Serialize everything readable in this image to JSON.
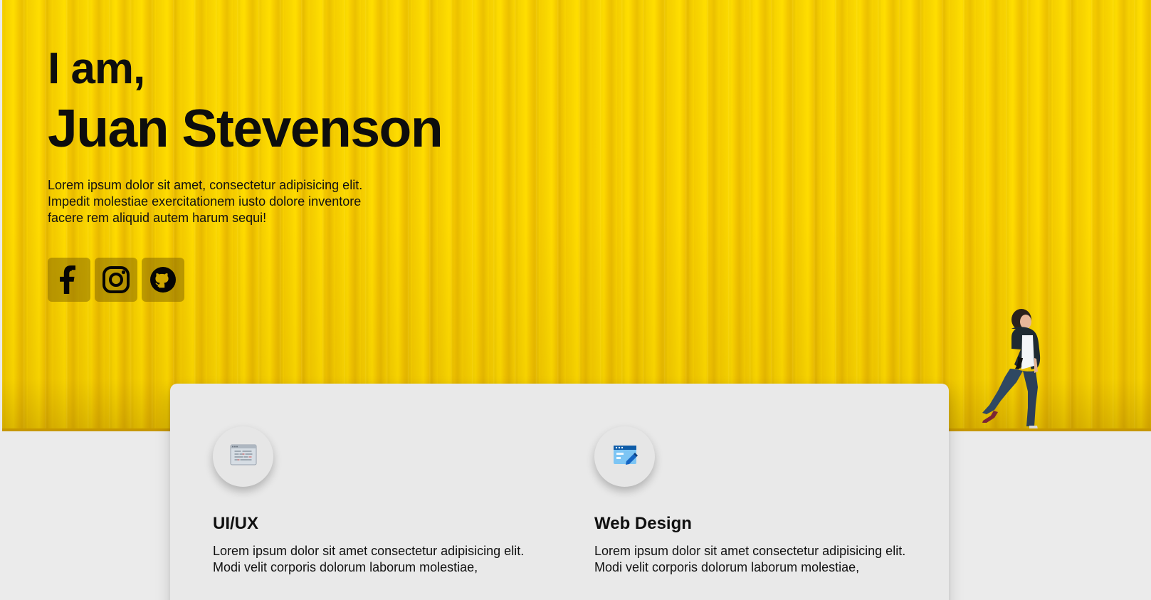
{
  "hero": {
    "intro_small": "I am,",
    "name": "Juan Stevenson",
    "description": "Lorem ipsum dolor sit amet, consectetur adipisicing elit. Impedit molestiae exercitationem iusto dolore inventore facere rem aliquid autem harum sequi!",
    "background_color": "#f5cf00",
    "social_links": [
      {
        "icon": "facebook-icon"
      },
      {
        "icon": "instagram-icon"
      },
      {
        "icon": "github-icon"
      }
    ]
  },
  "services": [
    {
      "icon": "code-window-icon",
      "title": "UI/UX",
      "description": "Lorem ipsum dolor sit amet consectetur adipisicing elit. Modi velit corporis dolorum laborum molestiae,"
    },
    {
      "icon": "web-design-icon",
      "title": "Web Design",
      "description": "Lorem ipsum dolor sit amet consectetur adipisicing elit. Modi velit corporis dolorum laborum molestiae,"
    }
  ]
}
